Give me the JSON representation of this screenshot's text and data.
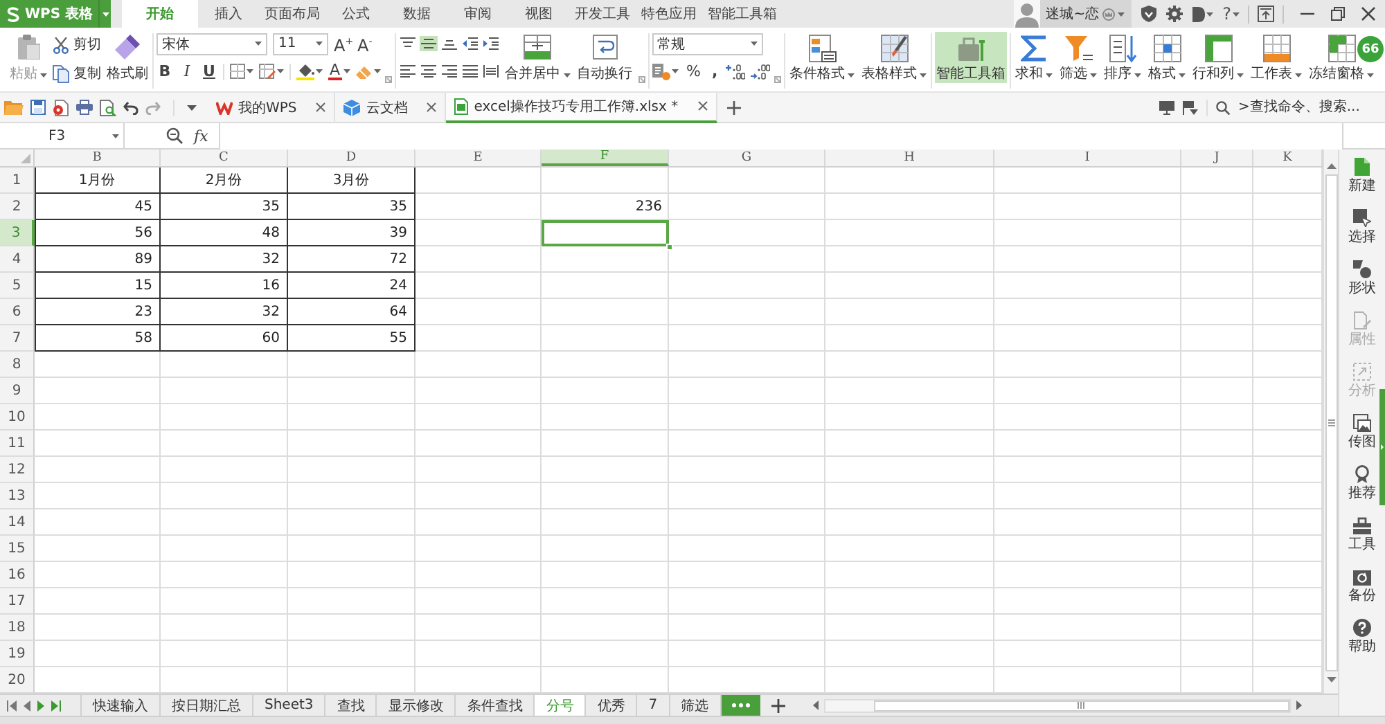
{
  "app_menu": {
    "label": "WPS 表格"
  },
  "ribbon_tabs": [
    {
      "label": "开始",
      "selected": true
    },
    {
      "label": "插入",
      "selected": false
    },
    {
      "label": "页面布局",
      "selected": false
    },
    {
      "label": "公式",
      "selected": false
    },
    {
      "label": "数据",
      "selected": false
    },
    {
      "label": "审阅",
      "selected": false
    },
    {
      "label": "视图",
      "selected": false
    },
    {
      "label": "开发工具",
      "selected": false
    },
    {
      "label": "特色应用",
      "selected": false
    },
    {
      "label": "智能工具箱",
      "selected": false
    }
  ],
  "account": {
    "name": "迷城~恋"
  },
  "title_bar": {
    "help": "?"
  },
  "float_badge": {
    "label": "66"
  },
  "ribbon": {
    "clipboard": {
      "paste": {
        "label": "粘贴",
        "disabled": true
      },
      "cut": {
        "label": "剪切",
        "disabled": false
      },
      "copy": {
        "label": "复制",
        "disabled": false
      },
      "format_painter": {
        "label": "格式刷",
        "disabled": false
      }
    },
    "font": {
      "name": "宋体",
      "size": "11",
      "grow": "A$^{+}$",
      "shrink": "A$^{-}$",
      "styles": [
        {
          "label": "B",
          "on": false
        },
        {
          "label": "I",
          "on": false
        },
        {
          "label": "U",
          "on": false
        }
      ],
      "color_label": "A"
    },
    "alignment": {
      "vertical": [
        {
          "selected": false
        },
        {
          "selected": true
        },
        {
          "selected": false
        }
      ],
      "horizontal": [
        {
          "selected": false
        },
        {
          "selected": false
        },
        {
          "selected": false
        },
        {
          "selected": false
        },
        {
          "selected": false
        }
      ],
      "merge": {
        "label": "合并居中",
        "dropdown": true
      },
      "wrap": {
        "label": "自动换行",
        "dropdown": false
      }
    },
    "number": {
      "format": "常规",
      "percent": "%",
      "thousands": ","
    },
    "tool_groups": [
      {
        "items": [
          {
            "label": "条件格式",
            "dropdown": true,
            "on": false
          },
          {
            "label": "表格样式",
            "dropdown": true,
            "on": false
          }
        ]
      },
      {
        "items": [
          {
            "label": "智能工具箱",
            "dropdown": false,
            "on": true
          }
        ]
      },
      {
        "items": [
          {
            "label": "求和",
            "dropdown": true,
            "on": false
          },
          {
            "label": "筛选",
            "dropdown": true,
            "on": false
          },
          {
            "label": "排序",
            "dropdown": true,
            "on": false
          },
          {
            "label": "格式",
            "dropdown": true,
            "on": false
          },
          {
            "label": "行和列",
            "dropdown": true,
            "on": false
          },
          {
            "label": "工作表",
            "dropdown": true,
            "on": false
          },
          {
            "label": "冻结窗格",
            "dropdown": true,
            "on": false
          }
        ]
      }
    ]
  },
  "document_tabs": [
    {
      "kind": "home",
      "label": "我的WPS",
      "selected": false
    },
    {
      "kind": "cloud",
      "label": "云文档",
      "selected": false
    },
    {
      "kind": "workbook",
      "label": "excel操作技巧专用工作簿.xlsx *",
      "selected": true
    }
  ],
  "command_search": {
    "placeholder": ">查找命令、搜索..."
  },
  "formula_bar": {
    "cell_reference": "F3",
    "function_label": "fx"
  },
  "sheet": {
    "columns": [
      {
        "label": "B",
        "selected": false
      },
      {
        "label": "C",
        "selected": false
      },
      {
        "label": "D",
        "selected": false
      },
      {
        "label": "E",
        "selected": false
      },
      {
        "label": "F",
        "selected": true
      },
      {
        "label": "G",
        "selected": false
      },
      {
        "label": "H",
        "selected": false
      },
      {
        "label": "I",
        "selected": false
      },
      {
        "label": "J",
        "selected": false
      },
      {
        "label": "K",
        "selected": false
      }
    ],
    "rows": [
      {
        "label": "1",
        "selected": false,
        "kind": "header",
        "cells": [
          "1月份",
          "2月份",
          "3月份"
        ]
      },
      {
        "label": "2",
        "selected": false,
        "kind": "data",
        "cells": [
          "45",
          "35",
          "35",
          null,
          "236"
        ]
      },
      {
        "label": "3",
        "selected": true,
        "kind": "data",
        "cells": [
          "56",
          "48",
          "39"
        ]
      },
      {
        "label": "4",
        "selected": false,
        "kind": "data",
        "cells": [
          "89",
          "32",
          "72"
        ]
      },
      {
        "label": "5",
        "selected": false,
        "kind": "data",
        "cells": [
          "15",
          "16",
          "24"
        ]
      },
      {
        "label": "6",
        "selected": false,
        "kind": "data",
        "cells": [
          "23",
          "32",
          "64"
        ]
      },
      {
        "label": "7",
        "selected": false,
        "kind": "data",
        "cells": [
          "58",
          "60",
          "55"
        ]
      },
      {
        "label": "8",
        "selected": false,
        "kind": "blank"
      },
      {
        "label": "9",
        "selected": false,
        "kind": "blank"
      },
      {
        "label": "10",
        "selected": false,
        "kind": "blank"
      },
      {
        "label": "11",
        "selected": false,
        "kind": "blank"
      },
      {
        "label": "12",
        "selected": false,
        "kind": "blank"
      },
      {
        "label": "13",
        "selected": false,
        "kind": "blank"
      },
      {
        "label": "14",
        "selected": false,
        "kind": "blank"
      },
      {
        "label": "15",
        "selected": false,
        "kind": "blank"
      },
      {
        "label": "16",
        "selected": false,
        "kind": "blank"
      },
      {
        "label": "17",
        "selected": false,
        "kind": "blank"
      },
      {
        "label": "18",
        "selected": false,
        "kind": "blank"
      },
      {
        "label": "19",
        "selected": false,
        "kind": "blank"
      },
      {
        "label": "20",
        "selected": false,
        "kind": "blank"
      }
    ]
  },
  "task_pane": [
    {
      "label": "新建",
      "disabled": false
    },
    {
      "label": "选择",
      "disabled": false
    },
    {
      "label": "形状",
      "disabled": false
    },
    {
      "label": "属性",
      "disabled": true
    },
    {
      "label": "分析",
      "disabled": true
    },
    {
      "label": "传图",
      "disabled": false
    },
    {
      "label": "推荐",
      "disabled": false
    },
    {
      "label": "工具",
      "disabled": false
    },
    {
      "label": "备份",
      "disabled": false
    },
    {
      "label": "帮助",
      "disabled": false
    }
  ],
  "sheet_tabs": [
    {
      "label": "快速输入",
      "selected": false
    },
    {
      "label": "按日期汇总",
      "selected": false
    },
    {
      "label": "Sheet3",
      "selected": false
    },
    {
      "label": "查找",
      "selected": false
    },
    {
      "label": "显示修改",
      "selected": false
    },
    {
      "label": "条件查找",
      "selected": false
    },
    {
      "label": "分号",
      "selected": true
    },
    {
      "label": "优秀",
      "selected": false
    },
    {
      "label": "7",
      "selected": false
    },
    {
      "label": "筛选",
      "selected": false
    }
  ]
}
